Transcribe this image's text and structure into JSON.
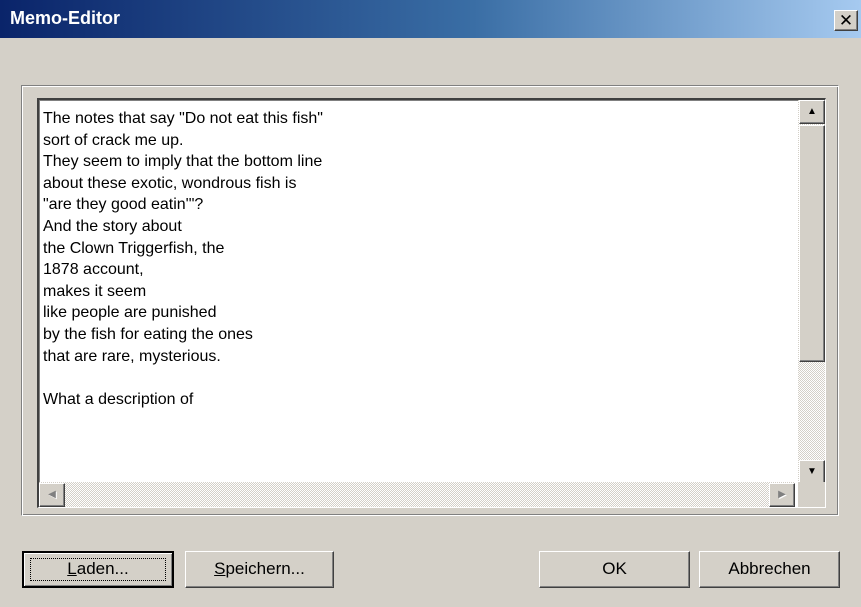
{
  "window": {
    "title": "Memo-Editor",
    "close_glyph": "✕",
    "close_icon": "close-icon",
    "colors": {
      "titlebar_start": "#0a246a",
      "titlebar_end": "#a6caf0",
      "face": "#d4d0c8"
    }
  },
  "memo": {
    "text": "The notes that say \"Do not eat this fish\"\nsort of crack me up.\nThey seem to imply that the bottom line\nabout these exotic, wondrous fish is\n\"are they good eatin'\"?\nAnd the story about\nthe Clown Triggerfish, the\n1878 account,\nmakes it seem\nlike people are punished\nby the fish for eating the ones\nthat are rare, mysterious.\n\nWhat a description of",
    "scroll_up_glyph": "▲",
    "scroll_down_glyph": "▼",
    "scroll_left_glyph": "◀",
    "scroll_right_glyph": "▶",
    "vertical_scroll_position": 0.0
  },
  "buttons": {
    "load_mnemonic": "L",
    "load_rest": "aden...",
    "save_mnemonic": "S",
    "save_rest": "peichern...",
    "ok": "OK",
    "cancel": "Abbrechen"
  }
}
